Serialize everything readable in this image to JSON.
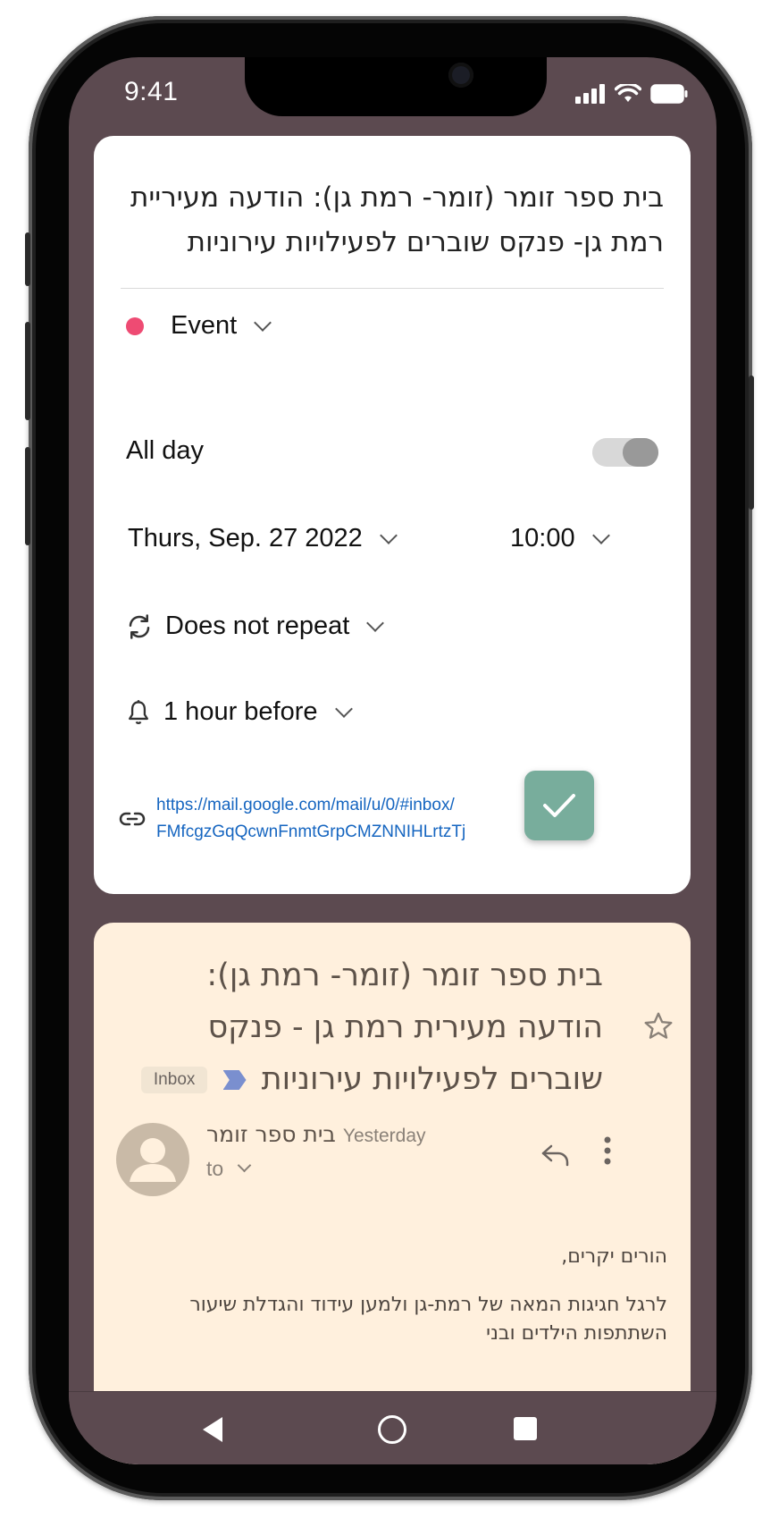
{
  "status_bar": {
    "time": "9:41"
  },
  "event_card": {
    "title": "בית ספר זומר (זומר- רמת גן): הודעה מעיריית רמת גן- פנקס שוברים לפעילויות עירוניות",
    "type_label": "Event",
    "type_color": "#ee4b73",
    "all_day_label": "All day",
    "all_day_on": false,
    "date": "Thurs, Sep. 27 2022",
    "time": "10:00",
    "repeat": "Does not repeat",
    "reminder": "1 hour before",
    "link_line1": "https://mail.google.com/mail/u/0/#inbox/",
    "link_line2": "FMfcgzGqQcwnFnmtGrpCMZNNIHLrtzTj",
    "save_icon": "check-icon"
  },
  "email": {
    "subject": "בית ספר זומר (זומר- רמת גן): הודעה מעירית רמת גן - פנקס שוברים לפעילויות עירוניות",
    "label": "Inbox",
    "sender": "בית ספר זומר",
    "time": "Yesterday",
    "to_label": "to",
    "greeting": "הורים יקרים,",
    "body_line1": "לרגל חגיגות המאה של רמת-גן ולמען עידוד והגדלת שיעור",
    "body_line2": "השתתפות הילדים ובני"
  },
  "navbar": {
    "back": "back-icon",
    "home": "home-icon",
    "recents": "recents-icon"
  }
}
